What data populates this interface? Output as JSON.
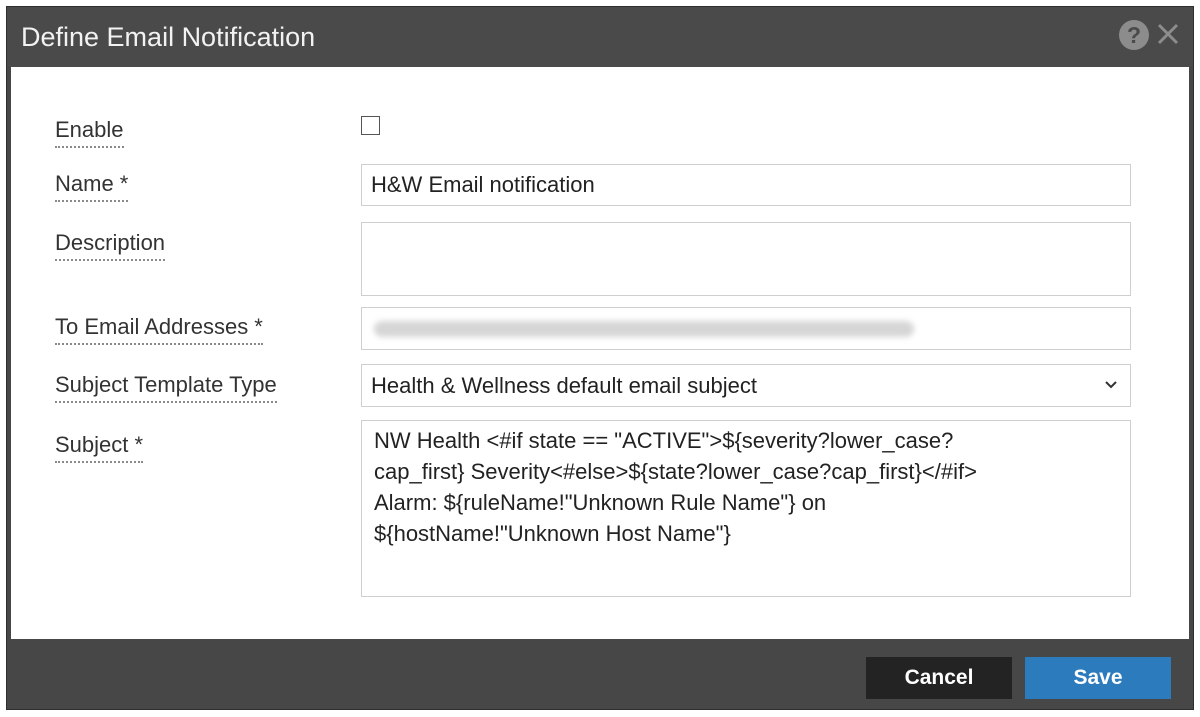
{
  "dialog": {
    "title": "Define Email Notification",
    "help_icon": "question-circle-icon",
    "close_icon": "close-icon"
  },
  "form": {
    "enable": {
      "label": "Enable",
      "checked": false
    },
    "name": {
      "label": "Name *",
      "value": "H&W Email notification"
    },
    "description": {
      "label": "Description",
      "value": ""
    },
    "to_email": {
      "label": "To Email Addresses *",
      "value_redacted": true
    },
    "subject_template_type": {
      "label": "Subject Template Type",
      "selected": "Health & Wellness default email subject"
    },
    "subject": {
      "label": "Subject *",
      "value": "NW Health <#if state == \"ACTIVE\">${severity?lower_case?\ncap_first} Severity<#else>${state?lower_case?cap_first}</#if>\nAlarm: ${ruleName!\"Unknown Rule Name\"} on\n${hostName!\"Unknown Host Name\"}"
    }
  },
  "footer": {
    "cancel_label": "Cancel",
    "save_label": "Save"
  },
  "colors": {
    "titlebar": "#4a4a4a",
    "save_button": "#2c7bbd",
    "cancel_button": "#232323"
  }
}
